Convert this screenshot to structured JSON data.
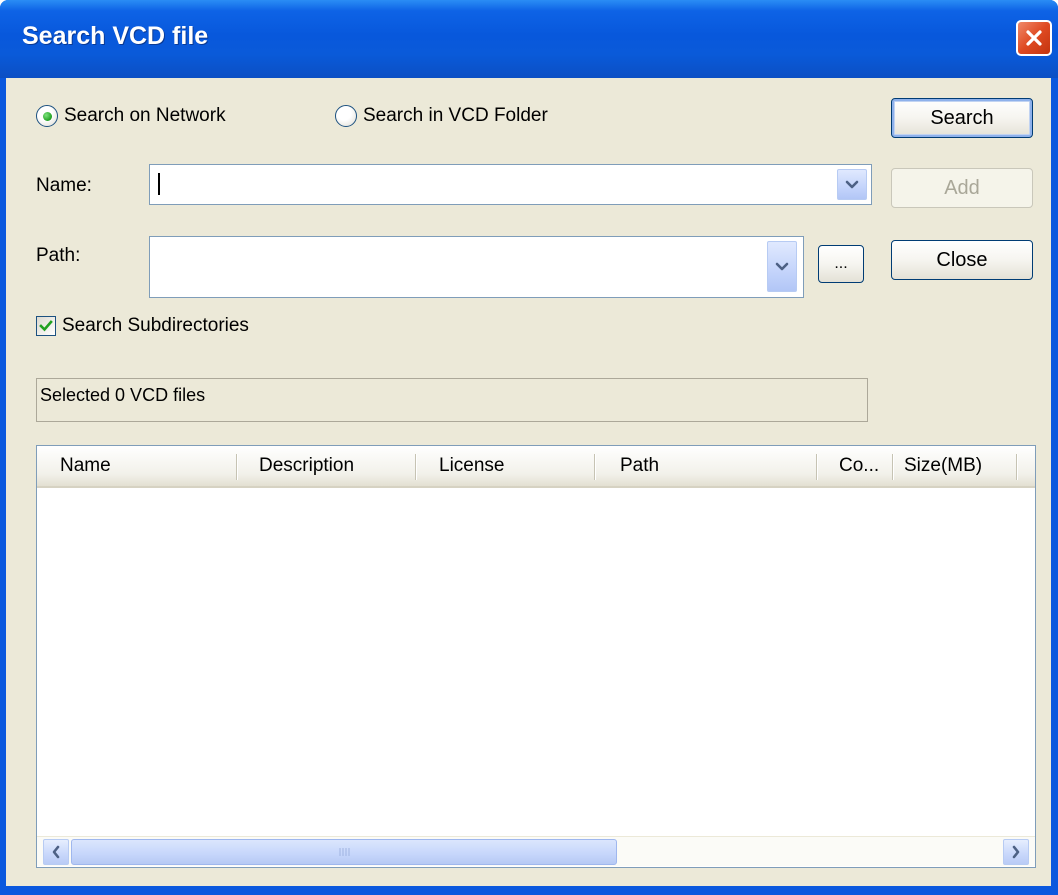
{
  "window": {
    "title": "Search VCD file"
  },
  "search_mode": {
    "network_label": "Search on Network",
    "folder_label": "Search in VCD Folder",
    "selected": "network"
  },
  "buttons": {
    "search": "Search",
    "add": "Add",
    "close": "Close",
    "browse": "..."
  },
  "fields": {
    "name_label": "Name:",
    "name_value": "",
    "path_label": "Path:",
    "path_value": ""
  },
  "options": {
    "subdirectories_label": "Search Subdirectories",
    "subdirectories_checked": true
  },
  "status": {
    "text": "Selected 0 VCD files"
  },
  "results": {
    "columns": [
      "Name",
      "Description",
      "License",
      "Path",
      "Co...",
      "Size(MB)"
    ],
    "rows": []
  },
  "colors": {
    "titlebar": "#0a58de",
    "client": "#ece9d8",
    "close": "#df4a22",
    "check": "#21a121"
  }
}
